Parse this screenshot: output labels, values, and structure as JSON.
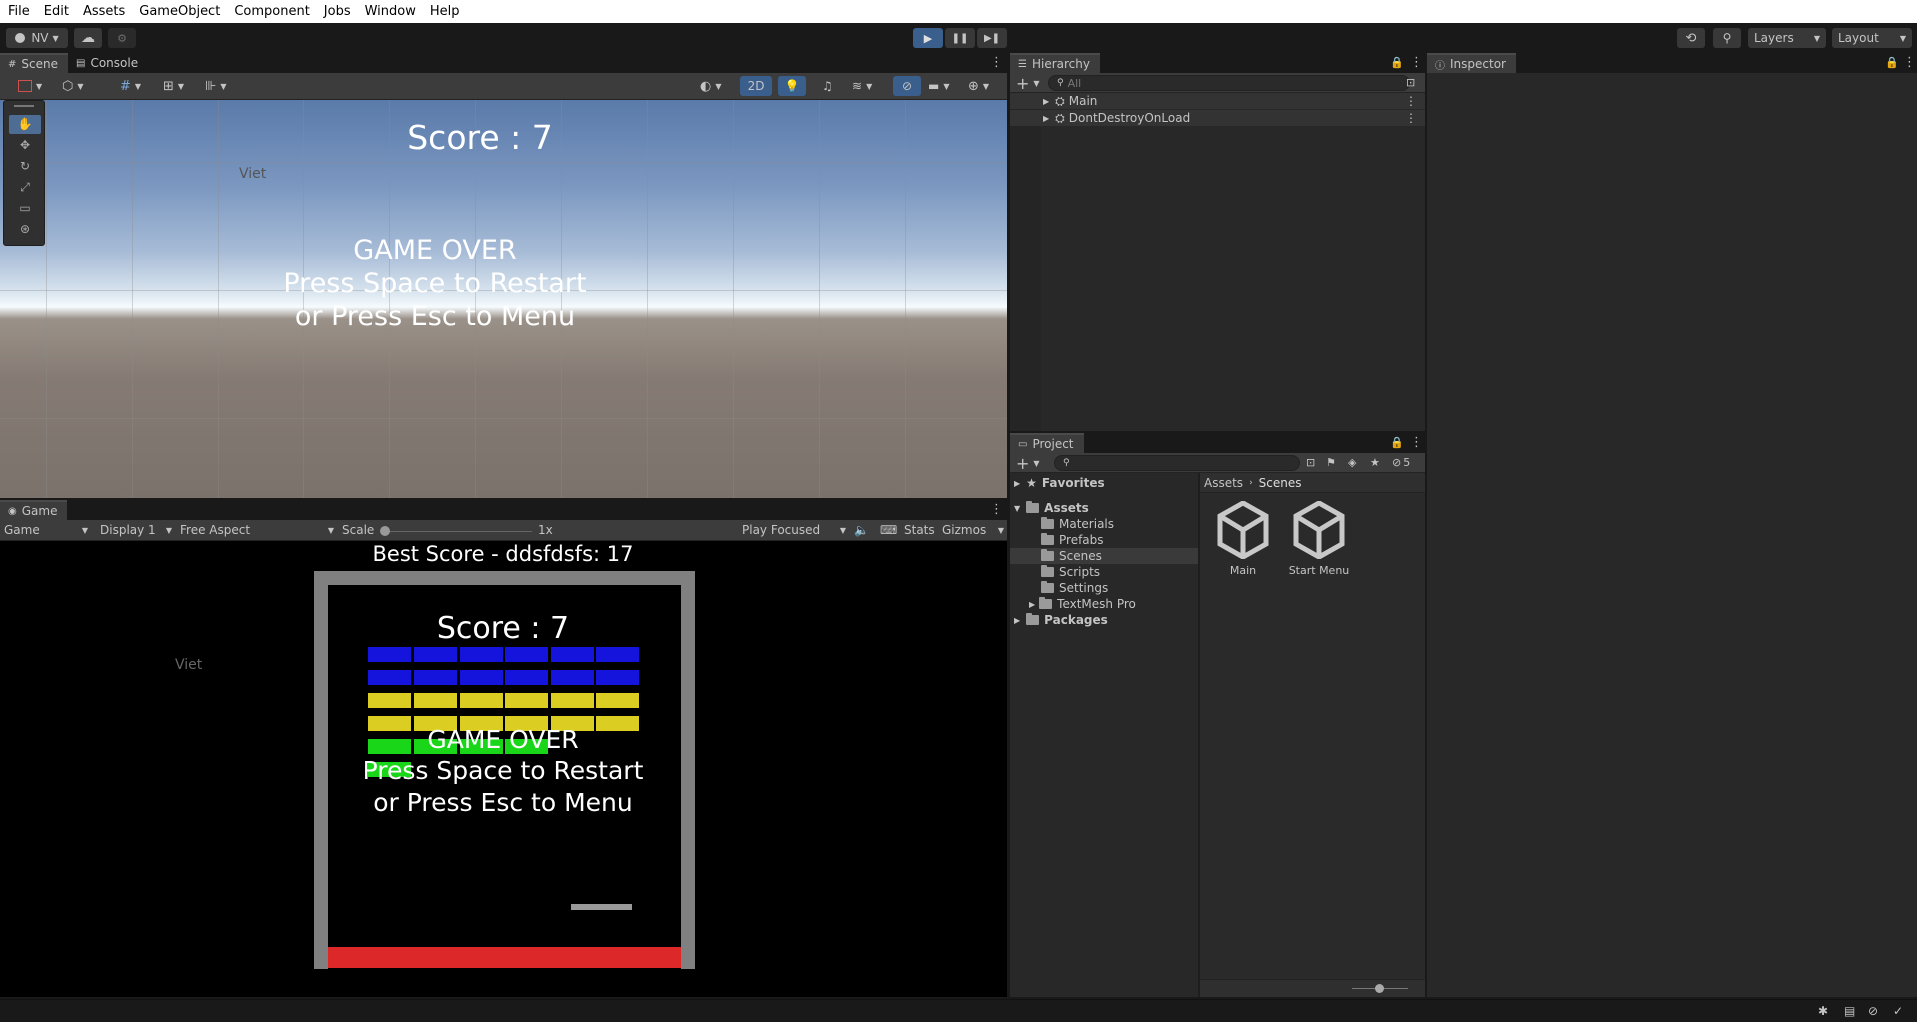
{
  "menu": [
    "File",
    "Edit",
    "Assets",
    "GameObject",
    "Component",
    "Jobs",
    "Window",
    "Help"
  ],
  "toolbar": {
    "account": "NV",
    "layers": "Layers",
    "layout": "Layout"
  },
  "scene_panel": {
    "tabs": [
      {
        "label": "Scene"
      },
      {
        "label": "Console"
      }
    ],
    "mode_2d": "2D",
    "score_text": "Score : 7",
    "game_over": "GAME OVER",
    "restart_text": "Press Space to Restart",
    "menu_text": "or Press Esc to Menu",
    "viet_label": "Viet"
  },
  "game_panel": {
    "tab": "Game",
    "game_dropdown": "Game",
    "display": "Display 1",
    "aspect": "Free Aspect",
    "scale_label": "Scale",
    "scale_value": "1x",
    "play_focused": "Play Focused",
    "stats": "Stats",
    "gizmos": "Gizmos",
    "best_score": "Best Score -  ddsfdsfs: 17",
    "score_text": "Score : 7",
    "game_over": "GAME OVER",
    "restart_text": "Press Space to Restart",
    "menu_text": "or Press Esc to Menu",
    "viet_label": "Viet",
    "colors": {
      "blue": "#1414dc",
      "yellow": "#dccd22",
      "green": "#19d619",
      "wall": "#808080",
      "floor": "#dc2828"
    }
  },
  "hierarchy": {
    "title": "Hierarchy",
    "search_placeholder": "All",
    "items": [
      {
        "label": "Main"
      },
      {
        "label": "DontDestroyOnLoad"
      }
    ]
  },
  "inspector": {
    "title": "Inspector"
  },
  "project": {
    "title": "Project",
    "hidden_count": "5",
    "favorites": "Favorites",
    "assets": "Assets",
    "folders": [
      {
        "label": "Materials"
      },
      {
        "label": "Prefabs"
      },
      {
        "label": "Scenes"
      },
      {
        "label": "Scripts"
      },
      {
        "label": "Settings"
      },
      {
        "label": "TextMesh Pro"
      }
    ],
    "packages": "Packages",
    "breadcrumb": [
      "Assets",
      "Scenes"
    ],
    "files": [
      {
        "label": "Main"
      },
      {
        "label": "Start Menu"
      }
    ]
  }
}
